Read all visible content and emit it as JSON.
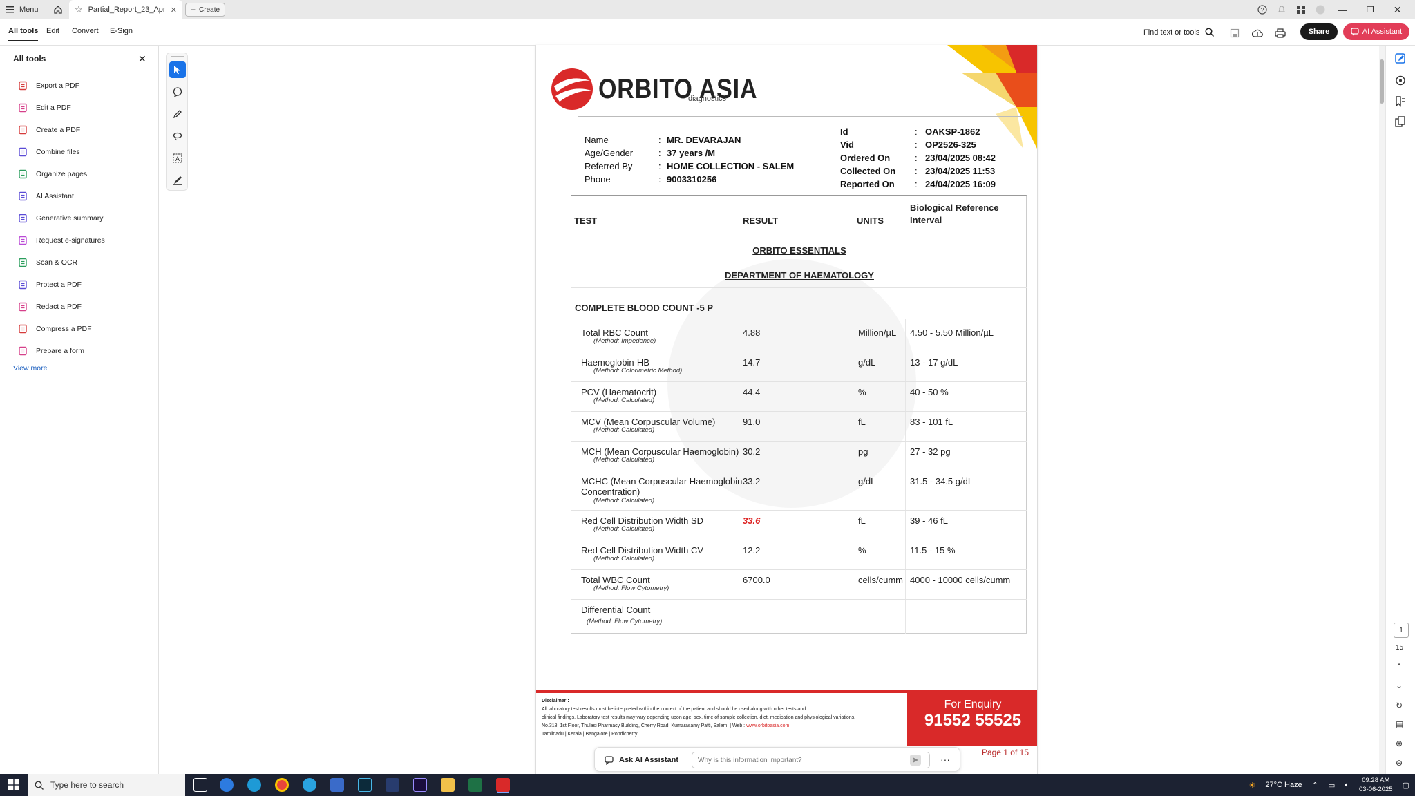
{
  "titlebar": {
    "menu_label": "Menu",
    "tab_title": "Partial_Report_23_Apr...",
    "create_label": "Create"
  },
  "menubar": {
    "tabs": [
      "All tools",
      "Edit",
      "Convert",
      "E-Sign"
    ],
    "find_label": "Find text or tools",
    "share_label": "Share",
    "ai_label": "AI Assistant"
  },
  "left_panel": {
    "title": "All tools",
    "items": [
      {
        "label": "Export a PDF",
        "icon": "export-pdf-icon",
        "color": "#d63b3b"
      },
      {
        "label": "Edit a PDF",
        "icon": "edit-pdf-icon",
        "color": "#d6408a"
      },
      {
        "label": "Create a PDF",
        "icon": "create-pdf-icon",
        "color": "#d63b3b"
      },
      {
        "label": "Combine files",
        "icon": "combine-files-icon",
        "color": "#5a4bd6"
      },
      {
        "label": "Organize pages",
        "icon": "organize-pages-icon",
        "color": "#2a9d5c"
      },
      {
        "label": "AI Assistant",
        "icon": "ai-assistant-icon",
        "color": "#5a4bd6"
      },
      {
        "label": "Generative summary",
        "icon": "generative-summary-icon",
        "color": "#5a4bd6"
      },
      {
        "label": "Request e-signatures",
        "icon": "request-esignatures-icon",
        "color": "#b94ad6"
      },
      {
        "label": "Scan & OCR",
        "icon": "scan-ocr-icon",
        "color": "#2a9d5c"
      },
      {
        "label": "Protect a PDF",
        "icon": "protect-pdf-icon",
        "color": "#5a4bd6"
      },
      {
        "label": "Redact a PDF",
        "icon": "redact-pdf-icon",
        "color": "#d6408a"
      },
      {
        "label": "Compress a PDF",
        "icon": "compress-pdf-icon",
        "color": "#d63b3b"
      },
      {
        "label": "Prepare a form",
        "icon": "prepare-form-icon",
        "color": "#d6408a"
      }
    ],
    "view_more": "View more"
  },
  "report": {
    "logo_text": "ORBITO ASIA",
    "logo_sub": "diagnostics",
    "patient": [
      {
        "label": "Name",
        "value": "MR. DEVARAJAN"
      },
      {
        "label": "Age/Gender",
        "value": "37 years /M"
      },
      {
        "label": "Referred By",
        "value": "HOME COLLECTION - SALEM"
      },
      {
        "label": "Phone",
        "value": "9003310256"
      }
    ],
    "meta": [
      {
        "label": "Id",
        "value": "OAKSP-1862"
      },
      {
        "label": "Vid",
        "value": "OP2526-325"
      },
      {
        "label": "Ordered On",
        "value": "23/04/2025 08:42"
      },
      {
        "label": "Collected On",
        "value": "23/04/2025 11:53"
      },
      {
        "label": "Reported On",
        "value": "24/04/2025 16:09"
      }
    ],
    "headers": {
      "test": "TEST",
      "result": "RESULT",
      "units": "UNITS",
      "bri": "Biological Reference Interval"
    },
    "section1": "ORBITO ESSENTIALS",
    "section2": "DEPARTMENT OF HAEMATOLOGY",
    "panel": "COMPLETE BLOOD COUNT -5 P",
    "rows": [
      {
        "name": "Total RBC Count",
        "method": "(Method: Impedence)",
        "result": "4.88",
        "unit": "Million/µL",
        "range": "4.50 - 5.50  Million/µL",
        "abnormal": false
      },
      {
        "name": "Haemoglobin-HB",
        "method": "(Method: Colorimetric Method)",
        "result": "14.7",
        "unit": "g/dL",
        "range": "13 - 17  g/dL",
        "abnormal": false
      },
      {
        "name": "PCV (Haematocrit)",
        "method": "(Method: Calculated)",
        "result": "44.4",
        "unit": "%",
        "range": "40 - 50  %",
        "abnormal": false
      },
      {
        "name": "MCV (Mean Corpuscular Volume)",
        "method": "(Method: Calculated)",
        "result": "91.0",
        "unit": "fL",
        "range": "83 - 101  fL",
        "abnormal": false
      },
      {
        "name": "MCH (Mean Corpuscular Haemoglobin)",
        "method": "(Method: Calculated)",
        "result": "30.2",
        "unit": "pg",
        "range": "27 - 32  pg",
        "abnormal": false
      },
      {
        "name": "MCHC (Mean Corpuscular Haemoglobin Concentration)",
        "method": "(Method: Calculated)",
        "result": "33.2",
        "unit": "g/dL",
        "range": "31.5 - 34.5  g/dL",
        "abnormal": false
      },
      {
        "name": "Red Cell Distribution Width SD",
        "method": "(Method: Calculated)",
        "result": "33.6",
        "unit": "fL",
        "range": "39 - 46  fL",
        "abnormal": true
      },
      {
        "name": "Red Cell Distribution Width CV",
        "method": "(Method: Calculated)",
        "result": "12.2",
        "unit": "%",
        "range": "11.5 - 15  %",
        "abnormal": false
      },
      {
        "name": "Total WBC Count",
        "method": "(Method: Flow Cytometry)",
        "result": "6700.0",
        "unit": "cells/cumm",
        "range": "4000 - 10000  cells/cumm",
        "abnormal": false
      },
      {
        "name": "Differential Count",
        "method": "(Method: Flow Cytometry)",
        "result": "",
        "unit": "",
        "range": "",
        "abnormal": false
      }
    ],
    "footer": {
      "disclaimer_title": "Disclaimer :",
      "disclaimer_1": "All laboratory test results must be interpreted within the context of the patient and should be used along with other tests and",
      "disclaimer_2": "clinical findings. Laboratory test results may vary depending upon age, sex, time of sample collection, diet, medication and physiological variations.",
      "address": "No.318, 1st Floor, Thulasi Pharmacy Building, Cherry Road, Kumarasamy Patti, Salem. | Web :",
      "web": "www.orbitoasia.com",
      "branches": "Tamilnadu | Kerala | Bangalore | Pondicherry",
      "enquiry_label": "For Enquiry",
      "enquiry_number": "91552 55525"
    },
    "page_label": "Page 1 of 15"
  },
  "ask_bar": {
    "label": "Ask AI Assistant",
    "placeholder": "Why is this information important?"
  },
  "page_nav": {
    "current": "1",
    "total": "15"
  },
  "taskbar": {
    "search_placeholder": "Type here to search",
    "weather": "27°C  Haze",
    "time": "09:28 AM",
    "date": "03-06-2025"
  },
  "colors": {
    "accent_blue": "#1a73e8",
    "ai_pink": "#e23d58",
    "report_red": "#d92929"
  }
}
